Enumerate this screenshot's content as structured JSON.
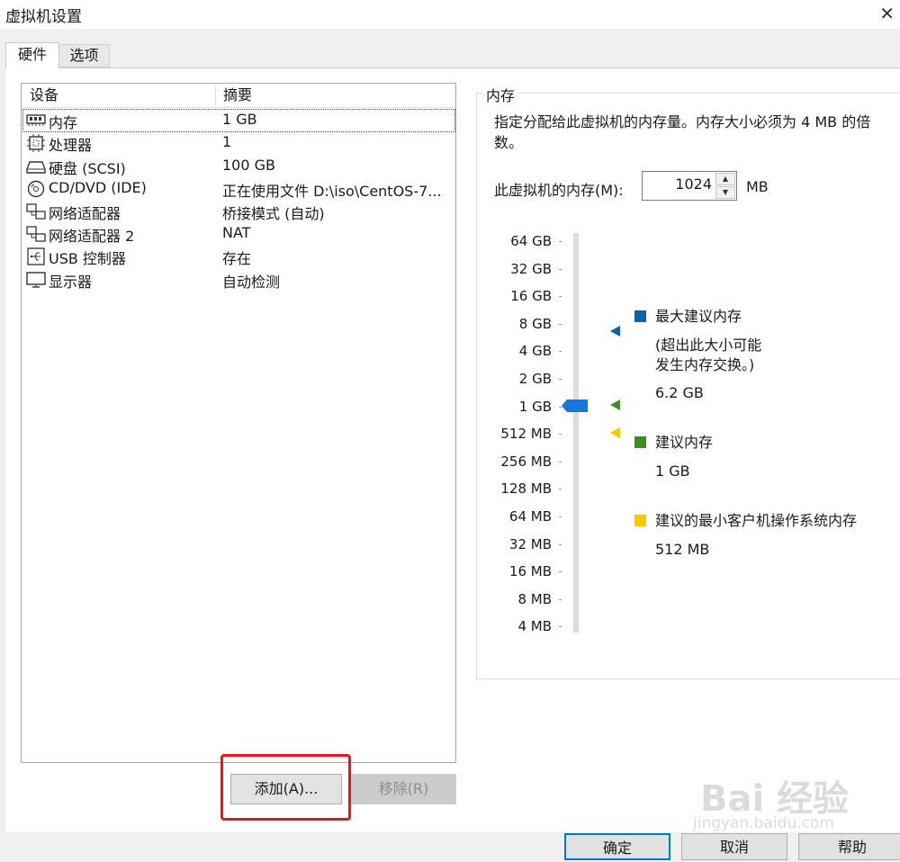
{
  "window": {
    "title": "虚拟机设置"
  },
  "tabs": [
    {
      "label": "硬件",
      "active": true
    },
    {
      "label": "选项",
      "active": false
    }
  ],
  "device_table": {
    "headers": [
      "设备",
      "摘要"
    ],
    "rows": [
      {
        "icon": "memory-icon",
        "name": "内存",
        "summary": "1 GB",
        "selected": true
      },
      {
        "icon": "processor-icon",
        "name": "处理器",
        "summary": "1"
      },
      {
        "icon": "hard-disk-icon",
        "name": "硬盘 (SCSI)",
        "summary": "100 GB"
      },
      {
        "icon": "cd-dvd-icon",
        "name": "CD/DVD (IDE)",
        "summary": "正在使用文件 D:\\iso\\CentOS-7..."
      },
      {
        "icon": "network-adapter-icon",
        "name": "网络适配器",
        "summary": "桥接模式 (自动)"
      },
      {
        "icon": "network-adapter-icon",
        "name": "网络适配器 2",
        "summary": "NAT"
      },
      {
        "icon": "usb-icon",
        "name": "USB 控制器",
        "summary": "存在"
      },
      {
        "icon": "display-icon",
        "name": "显示器",
        "summary": "自动检测"
      }
    ]
  },
  "buttons": {
    "add": "添加(A)...",
    "remove": "移除(R)"
  },
  "memory": {
    "section_title": "内存",
    "description": "指定分配给此虚拟机的内存量。内存大小必须为 4 MB 的倍数。",
    "field_label": "此虚拟机的内存(M):",
    "value": "1024",
    "unit": "MB",
    "scale_labels": [
      "64 GB",
      "32 GB",
      "16 GB",
      "8 GB",
      "4 GB",
      "2 GB",
      "1 GB",
      "512 MB",
      "256 MB",
      "128 MB",
      "64 MB",
      "32 MB",
      "16 MB",
      "8 MB",
      "4 MB"
    ],
    "current_level": "1 GB",
    "legend": {
      "max": {
        "title": "最大建议内存",
        "note_line1": "(超出此大小可能",
        "note_line2": "发生内存交换。)",
        "value": "6.2 GB",
        "color": "#0b62a8"
      },
      "recommended": {
        "title": "建议内存",
        "value": "1 GB",
        "color": "#3a8f1f"
      },
      "min": {
        "title": "建议的最小客户机操作系统内存",
        "value": "512 MB",
        "color": "#f2cc00"
      }
    }
  },
  "dialog_buttons": {
    "ok": "确定",
    "cancel": "取消",
    "help": "帮助"
  },
  "watermark": {
    "brand": "Bai 经验",
    "url": "jingyan.baidu.com"
  }
}
